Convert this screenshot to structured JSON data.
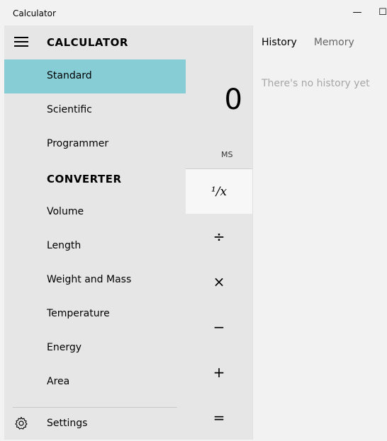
{
  "window": {
    "title": "Calculator",
    "minimize_glyph": "—",
    "maximize_glyph": "☐"
  },
  "menu": {
    "title": "CALCULATOR",
    "calculator_items": [
      {
        "label": "Standard",
        "selected": true
      },
      {
        "label": "Scientific",
        "selected": false
      },
      {
        "label": "Programmer",
        "selected": false
      }
    ],
    "converter_header": "CONVERTER",
    "converter_items": [
      {
        "label": "Volume"
      },
      {
        "label": "Length"
      },
      {
        "label": "Weight and Mass"
      },
      {
        "label": "Temperature"
      },
      {
        "label": "Energy"
      },
      {
        "label": "Area"
      }
    ],
    "settings_label": "Settings"
  },
  "calculator": {
    "display": "0",
    "ms_label": "MS",
    "keys": {
      "reciprocal": "¹/x",
      "divide": "÷",
      "multiply": "×",
      "subtract": "−",
      "add": "+",
      "equals": "="
    }
  },
  "side_panel": {
    "tabs": [
      "History",
      "Memory"
    ],
    "active_tab": "History",
    "empty_message": "There's no history yet"
  },
  "colors": {
    "selected_item": "#86cdd5",
    "menu_background": "#e6e6e6",
    "window_background": "#f2f2f2"
  }
}
